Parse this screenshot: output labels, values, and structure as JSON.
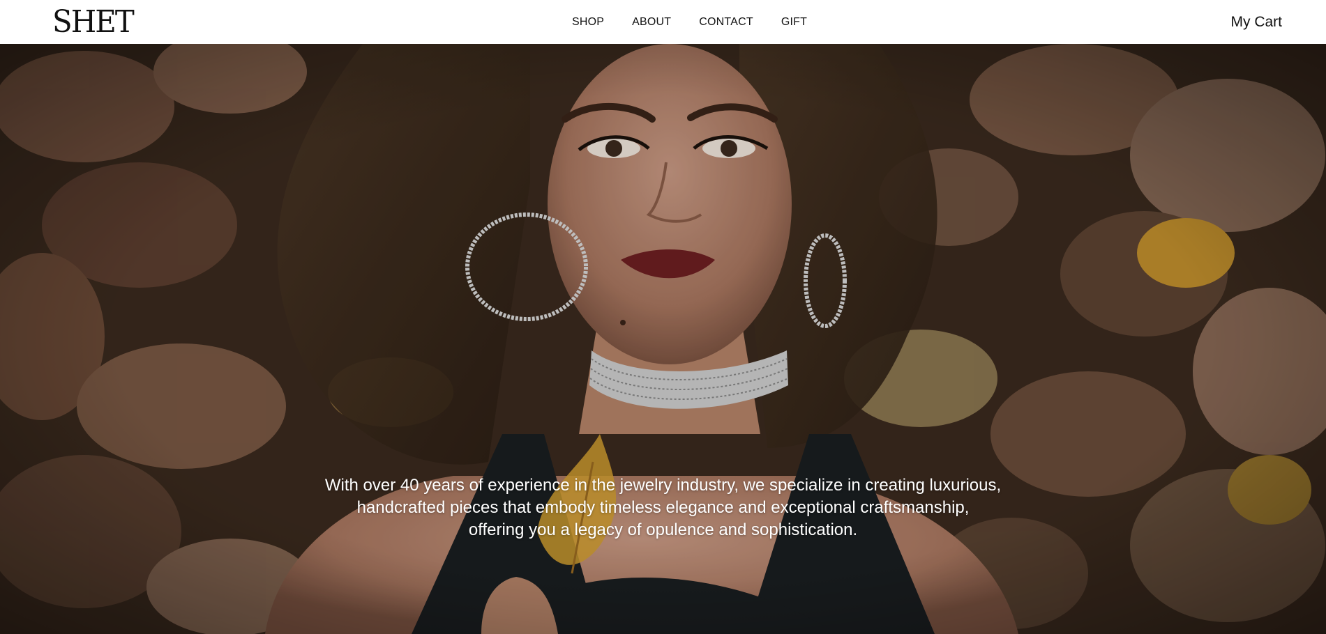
{
  "brand": {
    "logo_text": "SHET"
  },
  "nav": {
    "items": [
      {
        "label": "SHOP"
      },
      {
        "label": "ABOUT"
      },
      {
        "label": "CONTACT"
      },
      {
        "label": "GIFT"
      }
    ],
    "cart_label": "My Cart"
  },
  "hero": {
    "image_alt": "woman-lying-on-autumn-leaves-photo",
    "tagline_lines": [
      "With over 40 years of experience in the jewelry industry, we specialize in creating luxurious,",
      "handcrafted pieces that embody timeless elegance and exceptional craftsmanship,",
      "offering you a legacy of opulence and sophistication."
    ]
  },
  "colors": {
    "nav_background": "#ffffff",
    "nav_text": "#111111",
    "hero_text": "#ffffff",
    "leaf_brown": "#6b4a35",
    "leaf_gold": "#c9952e"
  }
}
